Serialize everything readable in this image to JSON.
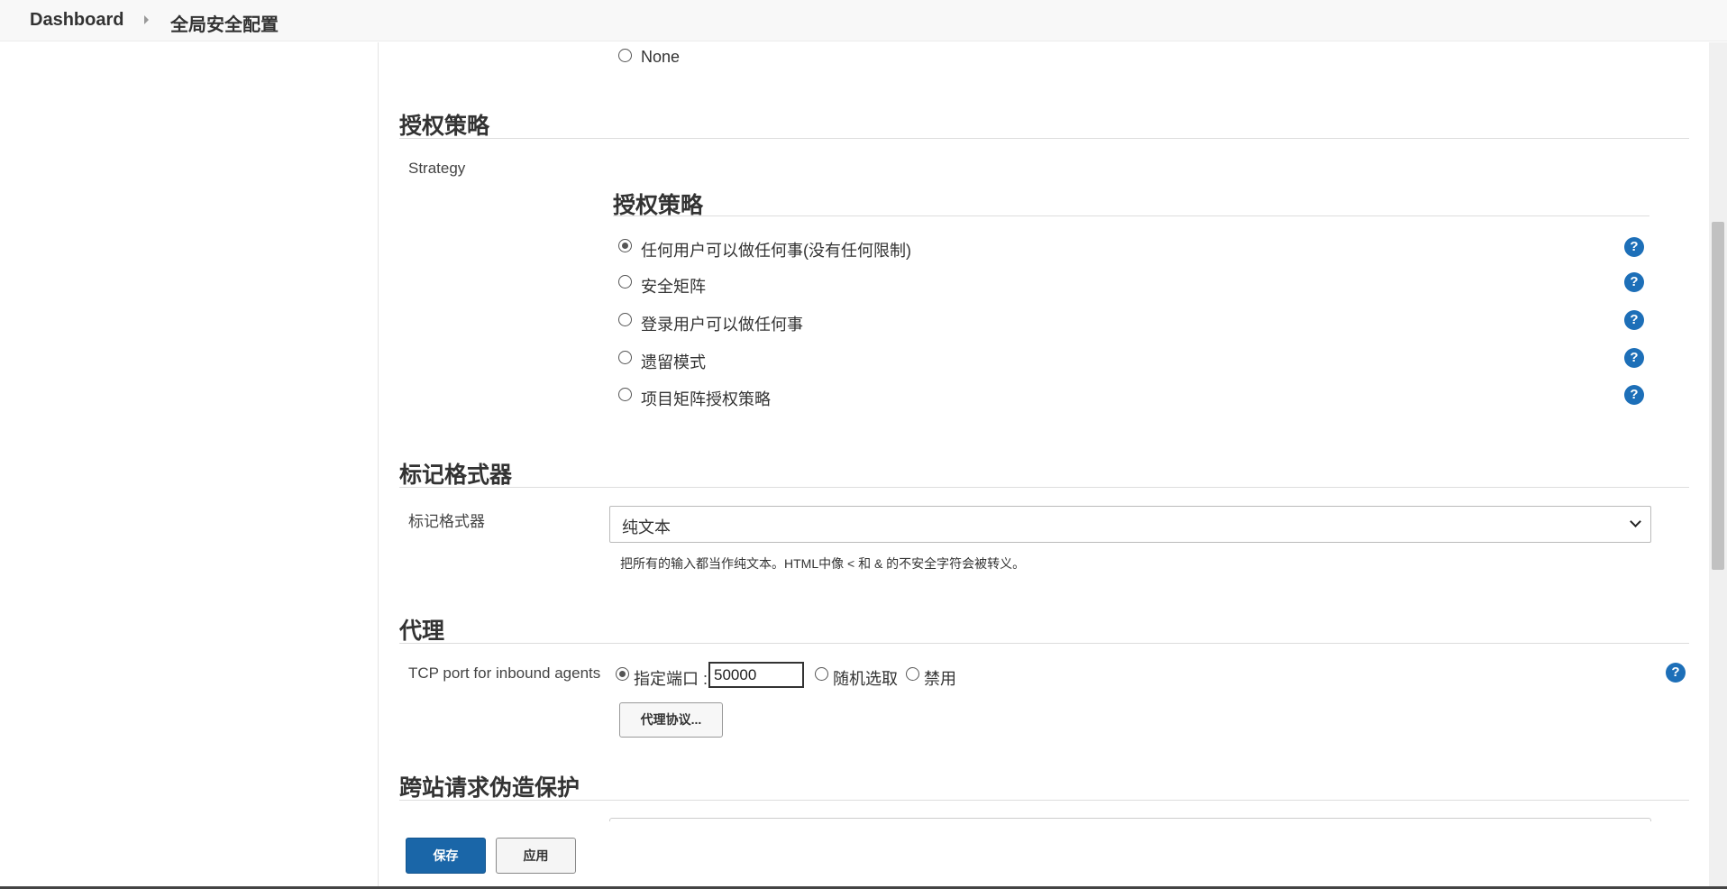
{
  "breadcrumb": {
    "home": "Dashboard",
    "current": "全局安全配置"
  },
  "security_realm": {
    "option_none": "None"
  },
  "authorization": {
    "section_title": "授权策略",
    "strategy_label": "Strategy",
    "sub_title": "授权策略",
    "options": [
      {
        "label": "任何用户可以做任何事(没有任何限制)",
        "selected": true
      },
      {
        "label": "安全矩阵",
        "selected": false
      },
      {
        "label": "登录用户可以做任何事",
        "selected": false
      },
      {
        "label": "遗留模式",
        "selected": false
      },
      {
        "label": "项目矩阵授权策略",
        "selected": false
      }
    ]
  },
  "markup_formatter": {
    "section_title": "标记格式器",
    "field_label": "标记格式器",
    "selected_value": "纯文本",
    "description": "把所有的输入都当作纯文本。HTML中像 < 和 & 的不安全字符会被转义。"
  },
  "agents": {
    "section_title": "代理",
    "tcp_label": "TCP port for inbound agents",
    "option_fixed": "指定端口 :",
    "port_value": "50000",
    "option_random": "随机选取",
    "option_disable": "禁用",
    "selected_option": "fixed",
    "protocols_button": "代理协议..."
  },
  "csrf": {
    "section_title": "跨站请求伪造保护"
  },
  "footer": {
    "save_label": "保存",
    "apply_label": "应用"
  },
  "help_icon_glyph": "?",
  "colors": {
    "accent": "#1a66a8",
    "help_icon": "#1d6fb8"
  }
}
